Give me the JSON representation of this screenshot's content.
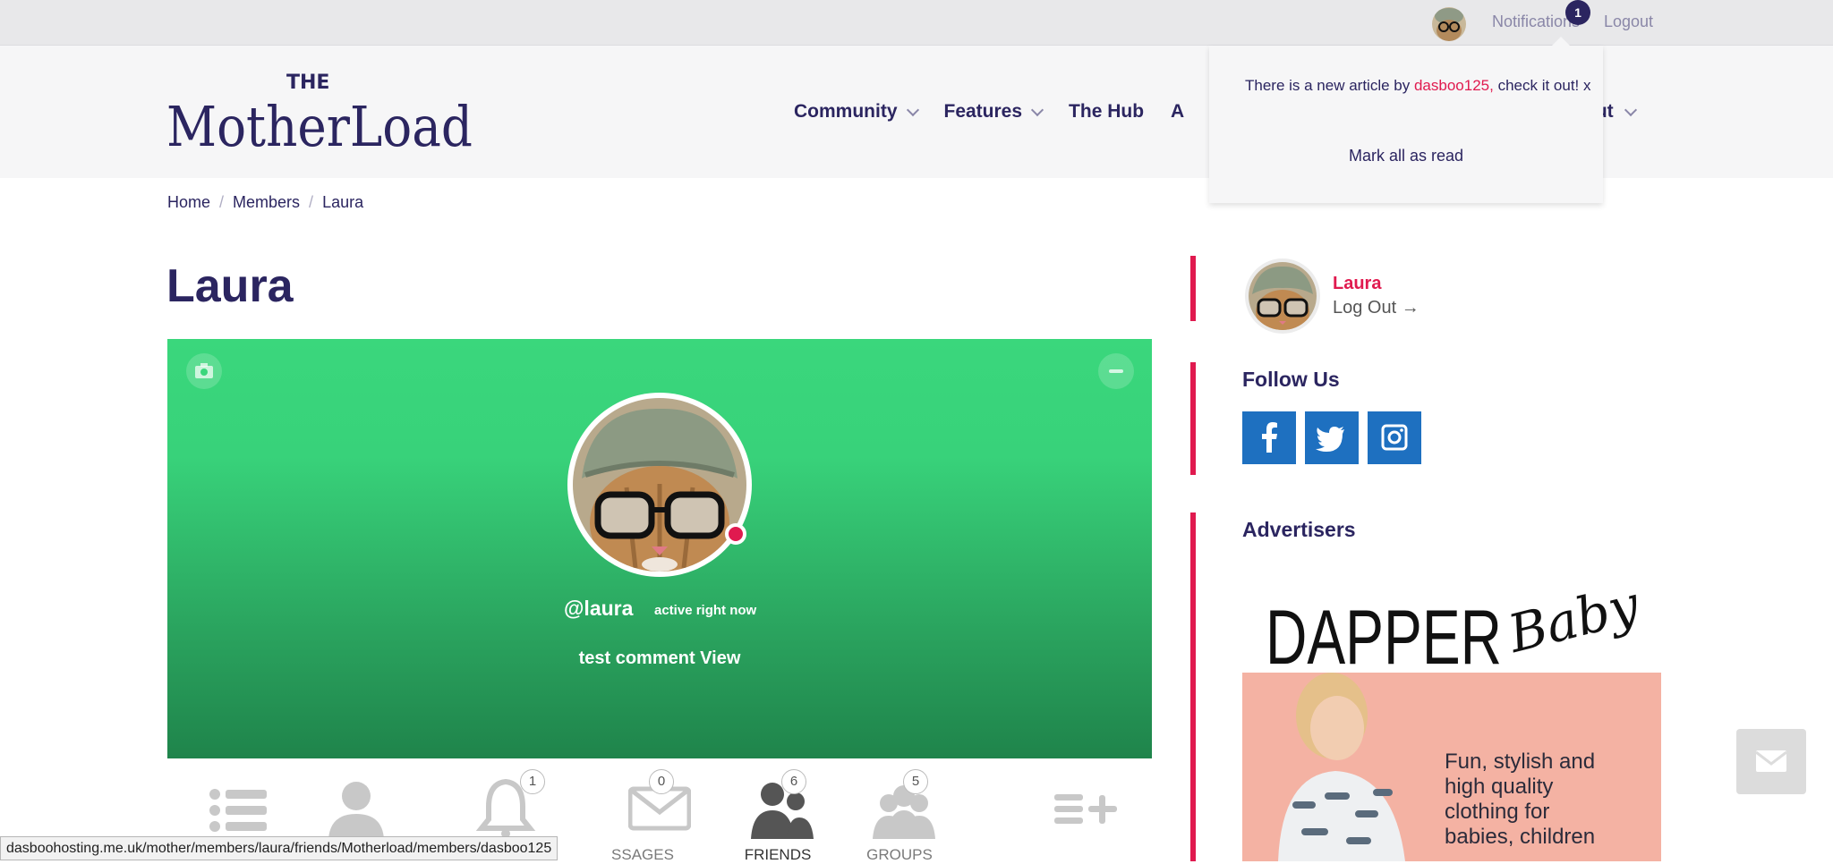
{
  "topbar": {
    "notifications_label": "Notifications",
    "notifications_count": "1",
    "logout_label": "Logout"
  },
  "header": {
    "logo_top": "THE",
    "logo_main": "MotherLoad",
    "nav": [
      {
        "label": "Community",
        "has_dropdown": true
      },
      {
        "label": "Features",
        "has_dropdown": true
      },
      {
        "label": "The Hub",
        "has_dropdown": false
      },
      {
        "label": "A",
        "has_dropdown": false
      }
    ],
    "nav_tail": "out"
  },
  "notification_dropdown": {
    "message_prefix": "There is a new article by ",
    "message_user": "dasboo125,",
    "message_suffix": " check it out!",
    "dismiss": "x",
    "mark_all": "Mark all as read"
  },
  "breadcrumb": [
    "Home",
    "Members",
    "Laura"
  ],
  "page_title": "Laura",
  "cover": {
    "handle": "@laura",
    "activity": "active right now",
    "latest_update": "test comment View"
  },
  "tabs": [
    {
      "label": "",
      "badge": "",
      "icon": "activity-list-icon"
    },
    {
      "label": "",
      "badge": "",
      "icon": "profile-icon"
    },
    {
      "label": "",
      "badge": "1",
      "icon": "bell-icon"
    },
    {
      "label": "SSAGES",
      "badge": "0",
      "icon": "envelope-icon"
    },
    {
      "label": "FRIENDS",
      "badge": "6",
      "icon": "friends-icon"
    },
    {
      "label": "GROUPS",
      "badge": "5",
      "icon": "groups-icon"
    },
    {
      "label": "",
      "badge": "",
      "icon": "add-list-icon"
    }
  ],
  "status_url": "dasboohosting.me.uk/mother/members/laura/friends/Motherload/members/dasboo125",
  "sidebar": {
    "user_name": "Laura",
    "logout_label": "Log Out →",
    "follow_title": "Follow Us",
    "social": [
      "facebook-icon",
      "twitter-icon",
      "instagram-icon"
    ],
    "advertisers_title": "Advertisers",
    "ad": {
      "brand_main": "DAPPER",
      "brand_script": "Baby",
      "tagline_lines": [
        "Fun, stylish and",
        "high quality",
        "clothing for",
        "babies, children"
      ]
    }
  },
  "colors": {
    "brand_navy": "#2b2560",
    "accent_pink": "#e01a4f",
    "cover_green": "#38d27a",
    "social_blue": "#1e70c0"
  }
}
